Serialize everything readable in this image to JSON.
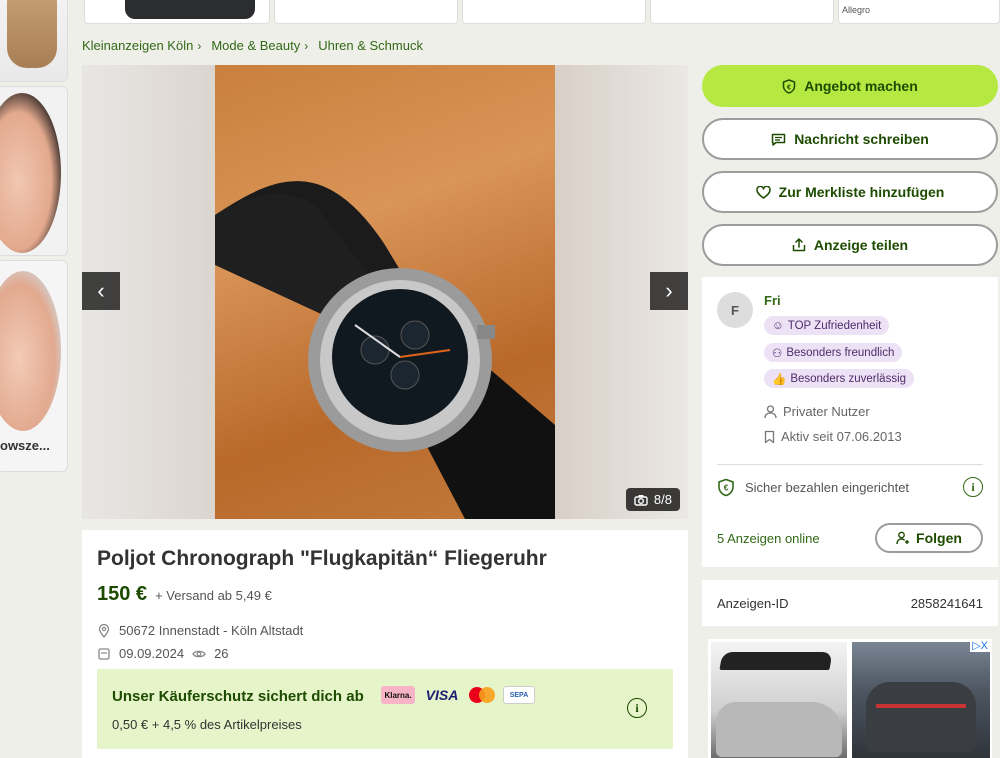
{
  "breadcrumb": [
    "Kleinanzeigen Köln",
    "Mode & Beauty",
    "Uhren & Schmuck"
  ],
  "left_ad": {
    "caption": "owsze..."
  },
  "top_ad": {
    "label": "Allegro"
  },
  "gallery": {
    "counter": "8/8",
    "prev": "‹",
    "next": "›"
  },
  "listing": {
    "title": "Poljot Chronograph \"Flugkapitän“ Fliegeruhr",
    "price": "150 €",
    "shipping": "+ Versand ab 5,49 €",
    "location": "50672 Innenstadt - Köln Altstadt",
    "date": "09.09.2024",
    "views": "26"
  },
  "protection": {
    "title": "Unser Käuferschutz sichert dich ab",
    "subtitle": "0,50 € + 4,5 % des Artikelpreises",
    "payment_methods": [
      "Klarna.",
      "VISA",
      "Mastercard",
      "SEPA"
    ],
    "info": "i"
  },
  "actions": {
    "offer": "Angebot machen",
    "message": "Nachricht schreiben",
    "watchlist": "Zur Merkliste hinzufügen",
    "share": "Anzeige teilen"
  },
  "seller": {
    "initial": "F",
    "name": "Fri",
    "badges": [
      "TOP Zufriedenheit",
      "Besonders freundlich",
      "Besonders zuverlässig"
    ],
    "type": "Privater Nutzer",
    "active_since": "Aktiv seit 07.06.2013",
    "secure_payment": "Sicher bezahlen eingerichtet",
    "ads_online": "5 Anzeigen online",
    "follow": "Folgen"
  },
  "ad_id": {
    "label": "Anzeigen-ID",
    "value": "2858241641"
  },
  "bottom_ad": {
    "close": "▷X"
  },
  "colors": {
    "accent": "#b5e941",
    "brand_green": "#326916",
    "dark_green": "#1d4b00",
    "badge_bg": "#ece1f5"
  }
}
